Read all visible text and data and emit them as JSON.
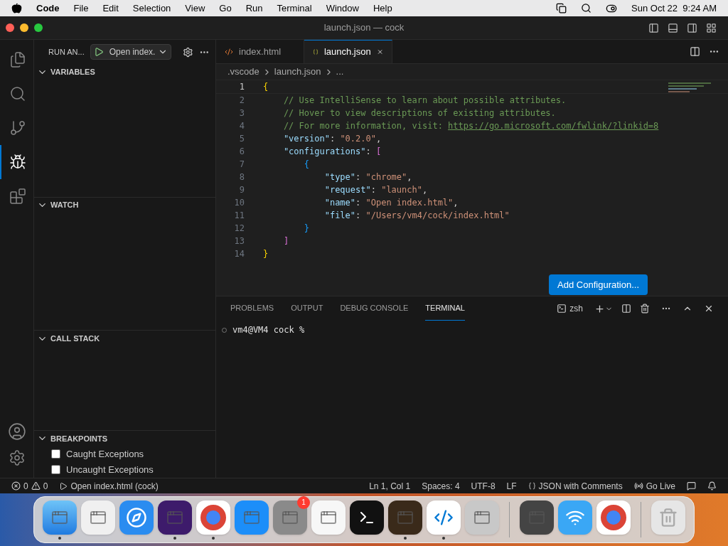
{
  "menubar": {
    "app": "Code",
    "items": [
      "File",
      "Edit",
      "Selection",
      "View",
      "Go",
      "Run",
      "Terminal",
      "Window",
      "Help"
    ],
    "clock": "Sun Oct 22  9:24 AM"
  },
  "window": {
    "title": "launch.json — cock"
  },
  "activity_bar": [
    {
      "kind": "files",
      "selected": false
    },
    {
      "kind": "search",
      "selected": false
    },
    {
      "kind": "scm",
      "selected": false
    },
    {
      "kind": "debug",
      "selected": true
    },
    {
      "kind": "extensions",
      "selected": false
    }
  ],
  "run_view": {
    "title": "RUN AN...",
    "config": "Open index.",
    "sections": [
      {
        "title": "VARIABLES",
        "expanded": true
      },
      {
        "title": "WATCH",
        "expanded": true
      },
      {
        "title": "CALL STACK",
        "expanded": true
      },
      {
        "title": "BREAKPOINTS",
        "expanded": true,
        "items": [
          {
            "label": "Caught Exceptions",
            "checked": false
          },
          {
            "label": "Uncaught Exceptions",
            "checked": false
          }
        ]
      }
    ]
  },
  "editor_tabs": [
    {
      "label": "index.html",
      "kind": "html",
      "selected": false
    },
    {
      "label": "launch.json",
      "kind": "json",
      "selected": true
    }
  ],
  "breadcrumb": [
    ".vscode",
    "launch.json",
    "..."
  ],
  "code": [
    {
      "n": "1",
      "tokens": [
        {
          "t": "{",
          "kind": "brace1"
        }
      ]
    },
    {
      "n": "2",
      "tokens": [
        {
          "t": "    // Use IntelliSense to learn about possible attributes.",
          "kind": "comment"
        }
      ]
    },
    {
      "n": "3",
      "tokens": [
        {
          "t": "    // Hover to view descriptions of existing attributes.",
          "kind": "comment"
        }
      ]
    },
    {
      "n": "4",
      "tokens": [
        {
          "t": "    // For more information, visit: ",
          "kind": "comment"
        },
        {
          "t": "https://go.microsoft.com/fwlink/?linkid=8",
          "kind": "link"
        }
      ]
    },
    {
      "n": "5",
      "tokens": [
        {
          "t": "    \"version\"",
          "kind": "key"
        },
        {
          "t": ": ",
          "kind": "punct"
        },
        {
          "t": "\"0.2.0\"",
          "kind": "string"
        },
        {
          "t": ",",
          "kind": "punct"
        }
      ]
    },
    {
      "n": "6",
      "tokens": [
        {
          "t": "    \"configurations\"",
          "kind": "key"
        },
        {
          "t": ": ",
          "kind": "punct"
        },
        {
          "t": "[",
          "kind": "brace2"
        }
      ]
    },
    {
      "n": "7",
      "tokens": [
        {
          "t": "        {",
          "kind": "brace3"
        }
      ]
    },
    {
      "n": "8",
      "tokens": [
        {
          "t": "            \"type\"",
          "kind": "key"
        },
        {
          "t": ": ",
          "kind": "punct"
        },
        {
          "t": "\"chrome\"",
          "kind": "string"
        },
        {
          "t": ",",
          "kind": "punct"
        }
      ]
    },
    {
      "n": "9",
      "tokens": [
        {
          "t": "            \"request\"",
          "kind": "key"
        },
        {
          "t": ": ",
          "kind": "punct"
        },
        {
          "t": "\"launch\"",
          "kind": "string"
        },
        {
          "t": ",",
          "kind": "punct"
        }
      ]
    },
    {
      "n": "10",
      "tokens": [
        {
          "t": "            \"name\"",
          "kind": "key"
        },
        {
          "t": ": ",
          "kind": "punct"
        },
        {
          "t": "\"Open index.html\"",
          "kind": "string"
        },
        {
          "t": ",",
          "kind": "punct"
        }
      ]
    },
    {
      "n": "11",
      "tokens": [
        {
          "t": "            \"file\"",
          "kind": "key"
        },
        {
          "t": ": ",
          "kind": "punct"
        },
        {
          "t": "\"/Users/vm4/cock/index.html\"",
          "kind": "string"
        }
      ]
    },
    {
      "n": "12",
      "tokens": [
        {
          "t": "        }",
          "kind": "brace3"
        }
      ]
    },
    {
      "n": "13",
      "tokens": [
        {
          "t": "    ]",
          "kind": "brace2"
        }
      ]
    },
    {
      "n": "14",
      "tokens": [
        {
          "t": "}",
          "kind": "brace1"
        }
      ]
    }
  ],
  "add_configuration_button": "Add Configuration...",
  "panel": {
    "tabs": [
      {
        "label": "PROBLEMS",
        "selected": false
      },
      {
        "label": "OUTPUT",
        "selected": false
      },
      {
        "label": "DEBUG CONSOLE",
        "selected": false
      },
      {
        "label": "TERMINAL",
        "selected": true
      }
    ],
    "shell": "zsh",
    "prompt": "vm4@VM4 cock %"
  },
  "status_bar": {
    "errors": "0",
    "warnings": "0",
    "launch": "Open index.html (cock)",
    "position": "Ln 1, Col 1",
    "spaces": "Spaces: 4",
    "encoding": "UTF-8",
    "eol": "LF",
    "language": "JSON with Comments",
    "live": "Go Live"
  },
  "dock": [
    {
      "apps": [
        {
          "kind": "finder",
          "running": true
        },
        {
          "kind": "launchpad",
          "running": false
        },
        {
          "kind": "safari",
          "running": false
        },
        {
          "kind": "firefox",
          "running": true
        },
        {
          "kind": "chrome",
          "running": true
        },
        {
          "kind": "appstore",
          "running": false
        },
        {
          "kind": "settings",
          "running": false,
          "badge": "1"
        },
        {
          "kind": "textedit",
          "running": false
        },
        {
          "kind": "terminal",
          "running": false
        },
        {
          "kind": "garageband",
          "running": true
        },
        {
          "kind": "vscode",
          "running": true
        },
        {
          "kind": "roblox",
          "running": false
        }
      ]
    },
    {
      "apps": [
        {
          "kind": "chess",
          "running": false
        },
        {
          "kind": "wifi",
          "running": false
        },
        {
          "kind": "chrome",
          "running": false
        }
      ]
    },
    {
      "apps": [
        {
          "kind": "trash",
          "running": false
        }
      ]
    }
  ]
}
